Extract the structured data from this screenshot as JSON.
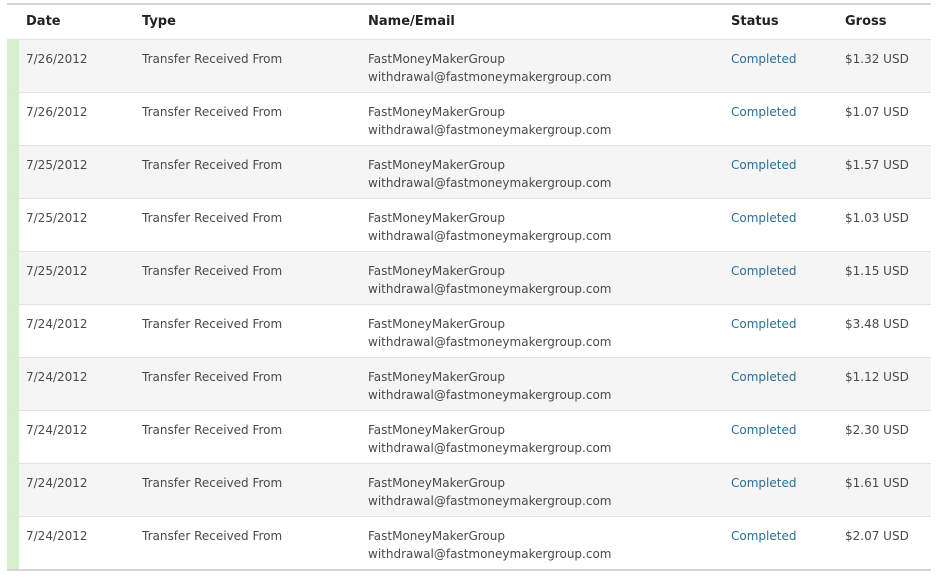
{
  "columns": {
    "date": "Date",
    "type": "Type",
    "name_email": "Name/Email",
    "status": "Status",
    "gross": "Gross"
  },
  "rows": [
    {
      "date": "7/26/2012",
      "type": "Transfer Received From",
      "name": "FastMoneyMakerGroup",
      "email": "withdrawal@fastmoneymakergroup.com",
      "status": "Completed",
      "gross": "$1.32 USD"
    },
    {
      "date": "7/26/2012",
      "type": "Transfer Received From",
      "name": "FastMoneyMakerGroup",
      "email": "withdrawal@fastmoneymakergroup.com",
      "status": "Completed",
      "gross": "$1.07 USD"
    },
    {
      "date": "7/25/2012",
      "type": "Transfer Received From",
      "name": "FastMoneyMakerGroup",
      "email": "withdrawal@fastmoneymakergroup.com",
      "status": "Completed",
      "gross": "$1.57 USD"
    },
    {
      "date": "7/25/2012",
      "type": "Transfer Received From",
      "name": "FastMoneyMakerGroup",
      "email": "withdrawal@fastmoneymakergroup.com",
      "status": "Completed",
      "gross": "$1.03 USD"
    },
    {
      "date": "7/25/2012",
      "type": "Transfer Received From",
      "name": "FastMoneyMakerGroup",
      "email": "withdrawal@fastmoneymakergroup.com",
      "status": "Completed",
      "gross": "$1.15 USD"
    },
    {
      "date": "7/24/2012",
      "type": "Transfer Received From",
      "name": "FastMoneyMakerGroup",
      "email": "withdrawal@fastmoneymakergroup.com",
      "status": "Completed",
      "gross": "$3.48 USD"
    },
    {
      "date": "7/24/2012",
      "type": "Transfer Received From",
      "name": "FastMoneyMakerGroup",
      "email": "withdrawal@fastmoneymakergroup.com",
      "status": "Completed",
      "gross": "$1.12 USD"
    },
    {
      "date": "7/24/2012",
      "type": "Transfer Received From",
      "name": "FastMoneyMakerGroup",
      "email": "withdrawal@fastmoneymakergroup.com",
      "status": "Completed",
      "gross": "$2.30 USD"
    },
    {
      "date": "7/24/2012",
      "type": "Transfer Received From",
      "name": "FastMoneyMakerGroup",
      "email": "withdrawal@fastmoneymakergroup.com",
      "status": "Completed",
      "gross": "$1.61 USD"
    },
    {
      "date": "7/24/2012",
      "type": "Transfer Received From",
      "name": "FastMoneyMakerGroup",
      "email": "withdrawal@fastmoneymakergroup.com",
      "status": "Completed",
      "gross": "$2.07 USD"
    }
  ],
  "colors": {
    "status_link": "#2a6f97",
    "row_marker": "#d6f0ce",
    "row_stripe": "#f5f5f5"
  }
}
